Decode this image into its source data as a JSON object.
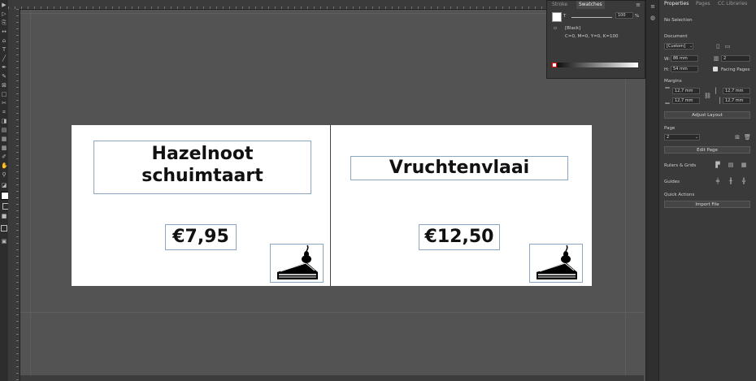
{
  "swatches": {
    "tabs": [
      "Stroke",
      "Swatches"
    ],
    "tint_value": "100",
    "tint_unit": "%",
    "color_name": "[Black]",
    "color_values": "C=0, M=0, Y=0, K=100"
  },
  "properties": {
    "tabs": [
      "Properties",
      "Pages",
      "CC Libraries"
    ],
    "selection": "No Selection",
    "document": {
      "title": "Document",
      "preset": "[Custom]",
      "width_label": "W:",
      "width": "86 mm",
      "height_label": "H:",
      "height": "54 mm",
      "pages_count": "2",
      "facing_pages": "Facing Pages"
    },
    "margins": {
      "title": "Margins",
      "top": "12,7 mm",
      "bottom": "12,7 mm",
      "left": "12,7 mm",
      "right": "12,7 mm",
      "adjust_layout": "Adjust Layout"
    },
    "page": {
      "title": "Page",
      "current": "2",
      "edit_page": "Edit Page"
    },
    "rulers_grids": "Rulers & Grids",
    "guides": "Guides",
    "quick_actions": {
      "title": "Quick Actions",
      "import_file": "Import File"
    }
  },
  "cards": [
    {
      "title_line1": "Hazelnoot",
      "title_line2": "schuimtaart",
      "price": "€7,95"
    },
    {
      "title_line1": "Vruchtenvlaai",
      "title_line2": "",
      "price": "€12,50"
    }
  ]
}
